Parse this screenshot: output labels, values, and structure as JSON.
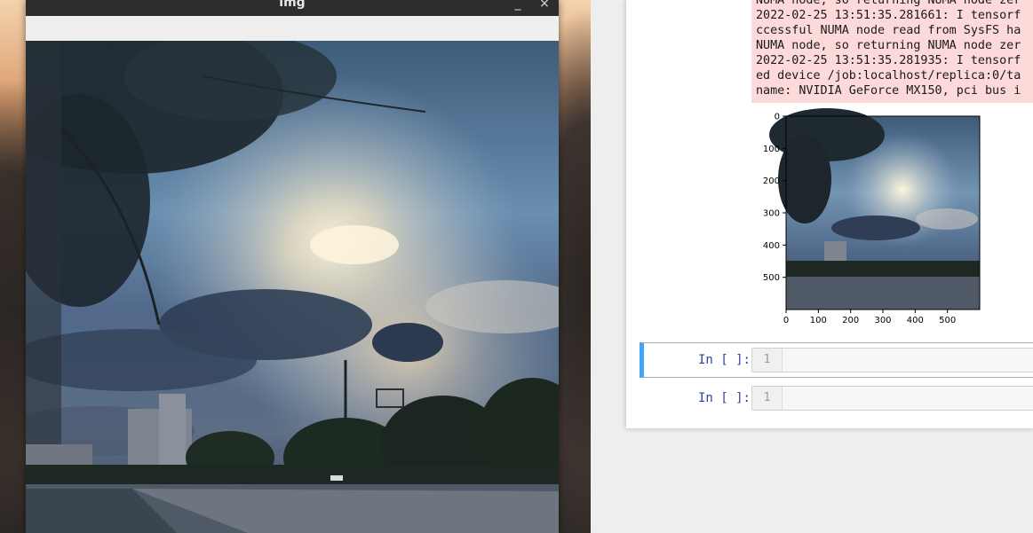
{
  "viewer": {
    "title": "img",
    "minimize_icon": "minimize-icon",
    "close_icon": "close-icon"
  },
  "notebook": {
    "stderr_lines": [
      "NUMA node, so returning NUMA node zer",
      "2022-02-25 13:51:35.281661: I tensorf",
      "ccessful NUMA node read from SysFS ha",
      "NUMA node, so returning NUMA node zer",
      "2022-02-25 13:51:35.281935: I tensorf",
      "ed device /job:localhost/replica:0/ta",
      "name: NVIDIA GeForce MX150, pci bus i"
    ],
    "plot": {
      "x_ticks": [
        "0",
        "100",
        "200",
        "300",
        "400",
        "500"
      ],
      "y_ticks": [
        "0",
        "100",
        "200",
        "300",
        "400",
        "500"
      ]
    },
    "cells": [
      {
        "prompt": "In [ ]:",
        "line_number": "1",
        "selected": true
      },
      {
        "prompt": "In [ ]:",
        "line_number": "1",
        "selected": false
      }
    ]
  },
  "colors": {
    "selected_cell_border": "#42a5f5",
    "stderr_background": "#fdd9d9",
    "prompt_color": "#303f9f"
  }
}
